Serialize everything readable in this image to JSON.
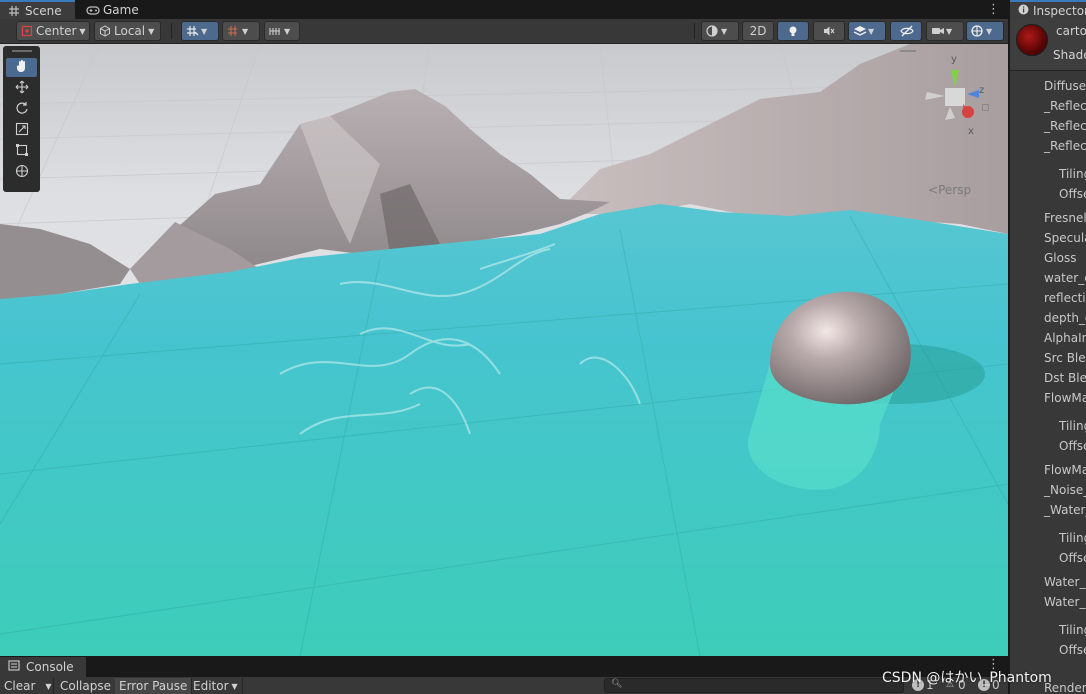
{
  "scene_tabs": [
    {
      "label": "Scene",
      "icon": "grid-icon"
    },
    {
      "label": "Game",
      "icon": "gamepad-icon"
    }
  ],
  "toolbar": {
    "pivot_label": "Center",
    "space_label": "Local",
    "mode_2d_label": "2D"
  },
  "tools": [
    "hand-tool",
    "move-tool",
    "rotate-tool",
    "scale-tool",
    "rect-tool",
    "transform-tool"
  ],
  "gizmo": {
    "persp_label": "Persp",
    "axes": {
      "y": "y",
      "z": "z",
      "x": "x"
    }
  },
  "colors": {
    "water": "#45cfc3",
    "accent": "#3a79bb",
    "mountain": "#a29a9c"
  },
  "console": {
    "tab_label": "Console",
    "buttons": [
      "Clear",
      "Collapse",
      "Error Pause",
      "Editor"
    ],
    "counts": {
      "log": "1",
      "warn": "0",
      "error": "0"
    }
  },
  "watermark": "CSDN @はかい_Phantom",
  "inspector": {
    "tab_label": "Inspector",
    "material_name": "carto",
    "shader_label": "Shade",
    "properties": [
      {
        "label": "Diffuse",
        "indent": 0
      },
      {
        "label": "_Reflec",
        "indent": 0
      },
      {
        "label": "_Reflec",
        "indent": 0
      },
      {
        "label": "_Reflec",
        "indent": 0
      },
      {
        "label": "Tiling",
        "indent": 1
      },
      {
        "label": "Offse",
        "indent": 1
      },
      {
        "label": "Fresnel",
        "indent": 0
      },
      {
        "label": "Specula",
        "indent": 0
      },
      {
        "label": "Gloss",
        "indent": 0
      },
      {
        "label": "water_c",
        "indent": 0
      },
      {
        "label": "reflectio",
        "indent": 0
      },
      {
        "label": "depth_c",
        "indent": 0
      },
      {
        "label": "AlphaIn",
        "indent": 0
      },
      {
        "label": "Src Bler",
        "indent": 0
      },
      {
        "label": "Dst Bler",
        "indent": 0
      },
      {
        "label": "FlowMa",
        "indent": 0
      },
      {
        "label": "Tiling",
        "indent": 1
      },
      {
        "label": "Offse",
        "indent": 1
      },
      {
        "label": "FlowMa",
        "indent": 0
      },
      {
        "label": "_Noise_",
        "indent": 0
      },
      {
        "label": "_Water_",
        "indent": 0
      },
      {
        "label": "Tiling",
        "indent": 1
      },
      {
        "label": "Offse",
        "indent": 1
      },
      {
        "label": "Water_s",
        "indent": 0
      },
      {
        "label": "Water_s",
        "indent": 0
      },
      {
        "label": "Tiling",
        "indent": 1
      },
      {
        "label": "Offse",
        "indent": 1
      },
      {
        "label": "Render",
        "indent": 0
      }
    ]
  }
}
